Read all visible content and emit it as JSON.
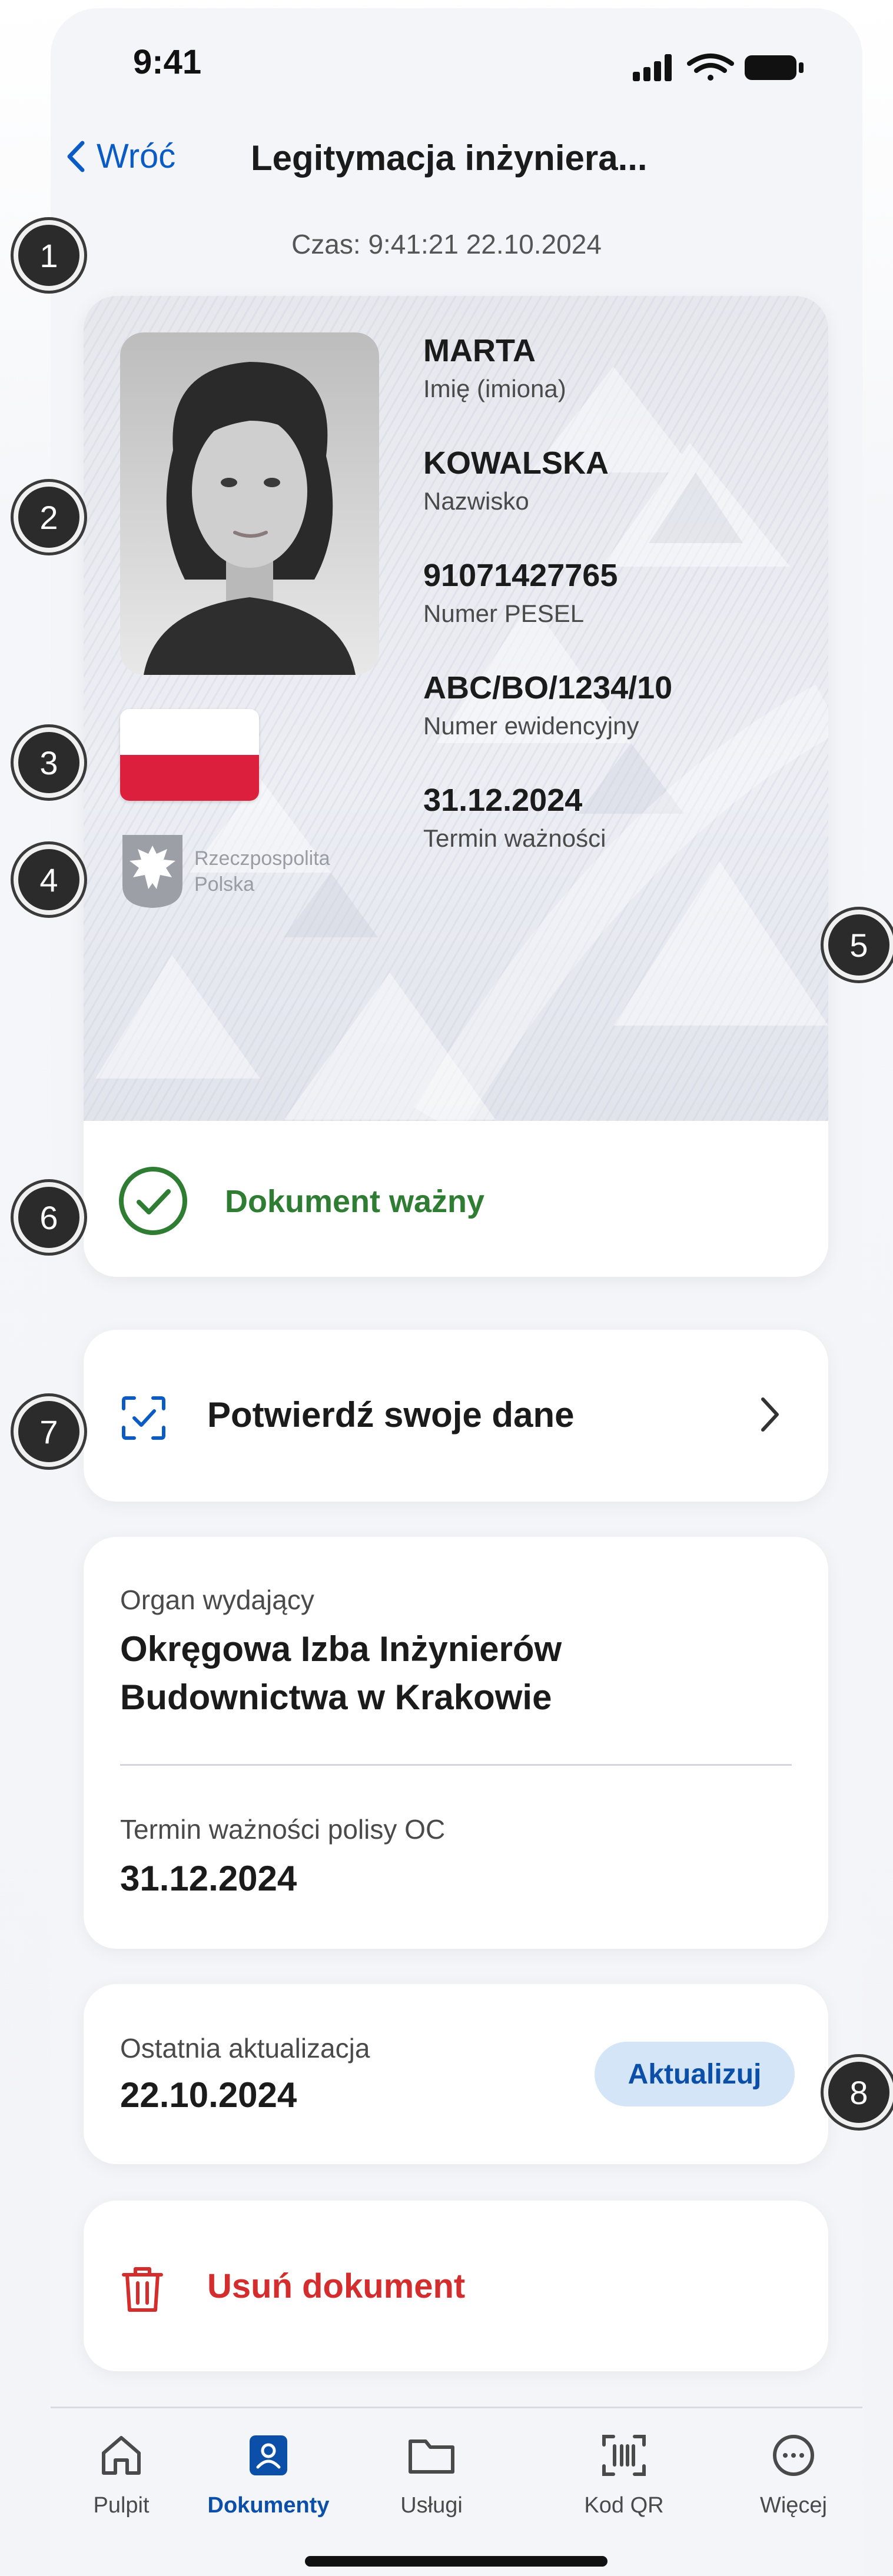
{
  "status_bar": {
    "time": "9:41"
  },
  "nav": {
    "back_label": "Wróć",
    "title": "Legitymacja inżyniera..."
  },
  "timestamp": "Czas: 9:41:21 22.10.2024",
  "markers": [
    "1",
    "2",
    "3",
    "4",
    "5",
    "6",
    "7",
    "8"
  ],
  "card": {
    "fields": [
      {
        "value": "MARTA",
        "label": "Imię (imiona)"
      },
      {
        "value": "KOWALSKA",
        "label": "Nazwisko"
      },
      {
        "value": "91071427765",
        "label": "Numer PESEL"
      },
      {
        "value": "ABC/BO/1234/10",
        "label": "Numer ewidencyjny"
      },
      {
        "value": "31.12.2024",
        "label": "Termin ważności"
      }
    ],
    "emblem_text_1": "Rzeczpospolita",
    "emblem_text_2": "Polska",
    "status_text": "Dokument ważny"
  },
  "confirm": {
    "label": "Potwierdź swoje dane"
  },
  "issuer": {
    "organ_label": "Organ wydający",
    "organ_line1": "Okręgowa Izba Inżynierów",
    "organ_line2": "Budownictwa w Krakowie",
    "policy_label": "Termin ważności polisy OC",
    "policy_value": "31.12.2024"
  },
  "update": {
    "label": "Ostatnia aktualizacja",
    "date": "22.10.2024",
    "button": "Aktualizuj"
  },
  "delete": {
    "label": "Usuń dokument"
  },
  "tabs": [
    {
      "label": "Pulpit",
      "icon": "home-icon"
    },
    {
      "label": "Dokumenty",
      "icon": "person-card-icon"
    },
    {
      "label": "Usługi",
      "icon": "folder-icon"
    },
    {
      "label": "Kod QR",
      "icon": "qr-scan-icon"
    },
    {
      "label": "Więcej",
      "icon": "more-icon"
    }
  ],
  "colors": {
    "accent": "#0b5bc7",
    "valid": "#2e7d32",
    "danger": "#d32d2d",
    "button_bg": "#d3e5f6"
  }
}
